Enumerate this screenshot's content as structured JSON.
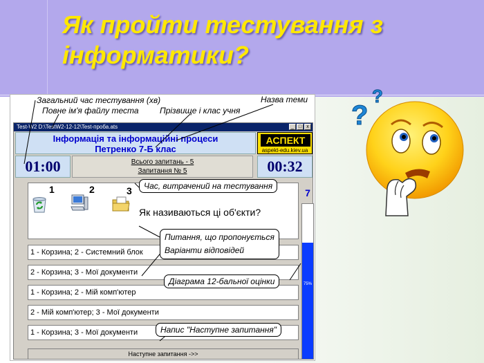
{
  "slide": {
    "title_line1": "Як пройти тестування з",
    "title_line2": "інформатики?"
  },
  "annotations": {
    "total_time": "Загальний час тестування (хв)",
    "file_name": "Повне ім'я файлу теста",
    "topic_name": "Назва теми",
    "student": "Прізвище і клас учня"
  },
  "window": {
    "title": "Test-W2    D:\\TestW2-12-12\\Test-проба.ats",
    "controls": [
      "_",
      "□",
      "x"
    ]
  },
  "app": {
    "topic": "Інформація та інформаційні процеси",
    "student": "Петренко 7-Б клас",
    "logo_brand": "АСПЕКТ",
    "logo_site": "aspekt-edu.kiev.ua",
    "total_timer": "01:00",
    "elapsed_timer": "00:32",
    "total_questions": "Всього запитань - 5",
    "question_number": "Запитання № 5",
    "question_numbers": [
      "1",
      "2",
      "3"
    ],
    "question_text": "Як називаються ці об'єкти?",
    "answers": [
      "1 - Корзина; 2 - Системний блок",
      "2 - Корзина; 3 - Мої документи",
      "1 - Корзина;  2 - Мій комп'ютер",
      "2 - Мій комп'ютер;  3 - Мої документи",
      "1 - Корзина;  3 - Мої документи"
    ],
    "next_button": "Наступне запитання ->>",
    "score_value": "7",
    "score_fraction": 0.75,
    "score_percent_label": "75%"
  },
  "callouts": {
    "time_spent": "Час, витрачений на тестування",
    "question": "Питання, що пропонується",
    "answer_options": "Варіанти відповідей",
    "score_chart": "Діаграма 12-бальної оцінки",
    "next_label": "Напис \"Наступне запитання\""
  },
  "icons": [
    "recycle-bin-icon",
    "computer-icon",
    "documents-folder-icon",
    "thinking-smiley-icon"
  ],
  "colors": {
    "title": "#ffe800",
    "header_band": "#b3a8ec",
    "app_accent": "#0000cc",
    "score_bar": "#0a3cff"
  }
}
